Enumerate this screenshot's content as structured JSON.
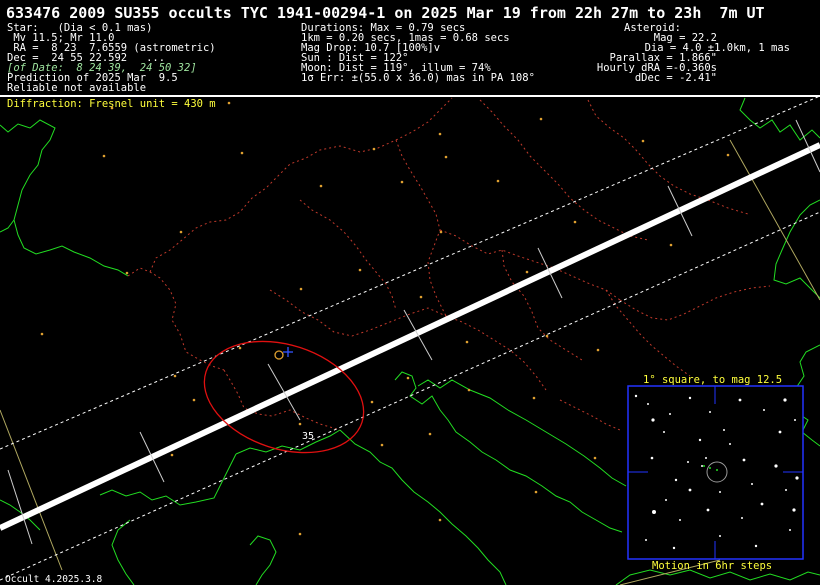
{
  "header": {
    "title": "633476 2009 SU355 occults TYC 1941-00294-1 on 2025 Mar 19 from 22h 27m to 23h  7m UT",
    "left": [
      "Star:   (Dia < 0.1 mas)",
      " Mv 11.5; Mr 11.0",
      " RA =  8 23  7.6559 (astrometric)",
      "Dec =  24 55 22.592   ...",
      "[of Date:  8 24 39,  24 50 32]",
      "Prediction of 2025 Mar  9.5",
      "Reliable not available"
    ],
    "center": [
      "Durations: Max = 0.79 secs",
      "1km = 0.20 secs, 1mas = 0.68 secs",
      "Mag Drop: 10.7 [100%]v",
      "Sun : Dist = 122°",
      "Moon: Dist = 119°, illum = 74%",
      "1σ Err: ±(55.0 x 36.0) mas in PA 108°"
    ],
    "right": [
      "Asteroid:",
      "Mag = 22.2",
      "Dia = 4.0 ±1.0km, 1 mas",
      "Parallax = 1.866\"",
      "Hourly dRA =-0.360s",
      "dDec = -2.41\""
    ]
  },
  "diffraction": "Diffraction: Fresnel unit = 430 m",
  "ellipse_label": "35",
  "inset": {
    "title": "1° square, to mag 12.5",
    "footer": "Motion in 6hr steps"
  },
  "software": "Occult 4.2025.3.8",
  "colors": {
    "background": "#000000",
    "text": "#ffffff",
    "highlight": "#ffff3c",
    "coast": "#22dd22",
    "border": "#c0392b",
    "path": "#ffffff",
    "error_ellipse": "#e01010",
    "site_marker": "#e0a030",
    "inset_frame": "#2233ff"
  }
}
